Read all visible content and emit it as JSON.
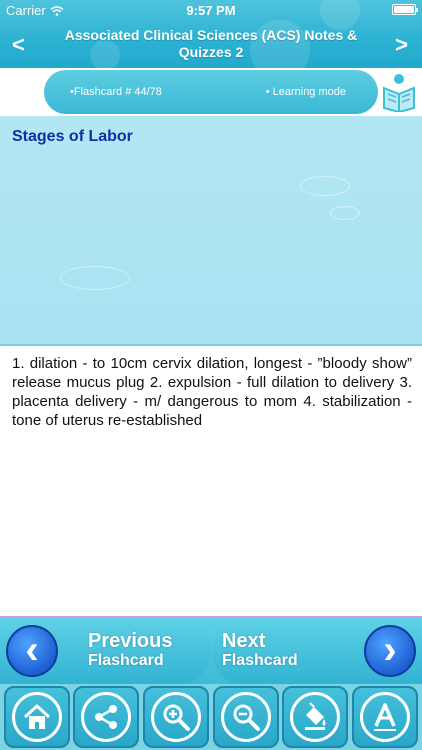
{
  "status": {
    "carrier": "Carrier",
    "time": "9:57 PM"
  },
  "header": {
    "title": "Associated Clinical Sciences (ACS) Notes & Quizzes 2",
    "prev_arrow": "<",
    "next_arrow": ">"
  },
  "flashcard_bar": {
    "count": "•Flashcard #  44/78",
    "mode": "• Learning mode"
  },
  "question": "Stages of Labor",
  "answer": "1. dilation - to 10cm cervix dilation, longest - ”bloody show” release mucus plug 2. expulsion - full dilation to delivery 3. placenta delivery - m/ dangerous to mom 4. stabilization - tone of uterus re-established",
  "nav": {
    "prev_line1": "Previous",
    "prev_line2": "Flashcard",
    "next_line1": "Next",
    "next_line2": "Flashcard"
  },
  "toolbar": {
    "icons": [
      "home-icon",
      "share-icon",
      "zoom-in-icon",
      "zoom-out-icon",
      "paint-bucket-icon",
      "font-icon"
    ]
  },
  "colors": {
    "header": "#2cb2d3",
    "question_bg": "#b3e6f3",
    "question_text": "#0f2fa8",
    "nav_circle": "#1f5fd4"
  }
}
